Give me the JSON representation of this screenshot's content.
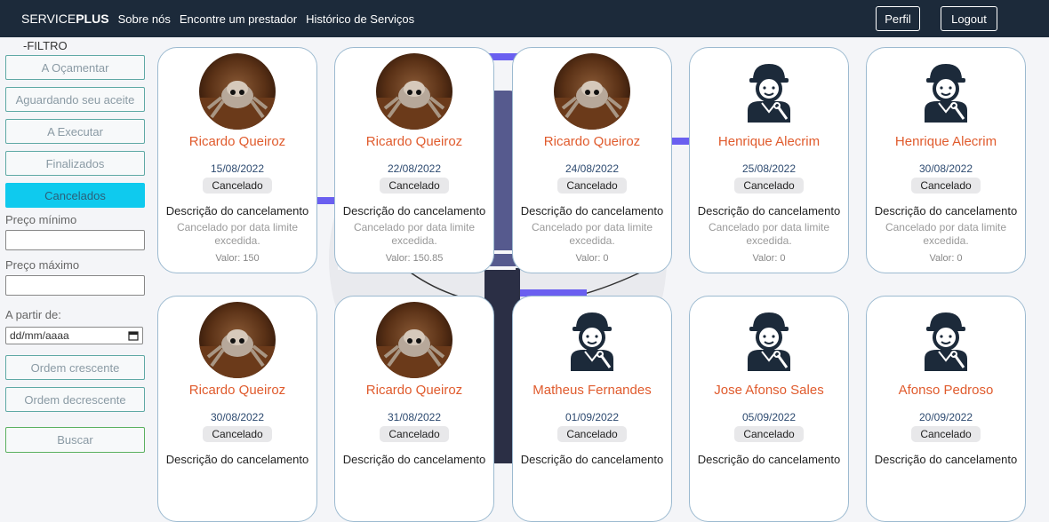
{
  "nav": {
    "brand_light": "SERVICE",
    "brand_bold": "PLUS",
    "links": [
      "Sobre nós",
      "Encontre um prestador",
      "Histórico de Serviços"
    ],
    "profile": "Perfil",
    "logout": "Logout"
  },
  "sidebar": {
    "title": "-FILTRO",
    "filters": [
      "A Oçamentar",
      "Aguardando seu aceite",
      "A Executar",
      "Finalizados",
      "Cancelados"
    ],
    "active_filter": "Cancelados",
    "min_price_label": "Preço mínimo",
    "max_price_label": "Preço máximo",
    "from_label": "A partir de:",
    "date_placeholder": "dd/mm/aaaa",
    "order_asc": "Ordem crescente",
    "order_desc": "Ordem decrescente",
    "search": "Buscar"
  },
  "colors": {
    "topbar": "#1c2a3a",
    "active_filter": "#0fcaee",
    "name": "#e05b2d",
    "date": "#2d4a70"
  },
  "cards": [
    {
      "avatar": "spider-photo",
      "name": "Ricardo Queiroz",
      "date": "15/08/2022",
      "status": "Cancelado",
      "desc_title": "Descrição do cancelamento",
      "desc": "Cancelado por data limite excedida.",
      "value": "Valor: 150"
    },
    {
      "avatar": "spider-photo",
      "name": "Ricardo Queiroz",
      "date": "22/08/2022",
      "status": "Cancelado",
      "desc_title": "Descrição do cancelamento",
      "desc": "Cancelado por data limite excedida.",
      "value": "Valor: 150.85"
    },
    {
      "avatar": "spider-photo",
      "name": "Ricardo Queiroz",
      "date": "24/08/2022",
      "status": "Cancelado",
      "desc_title": "Descrição do cancelamento",
      "desc": "Cancelado por data limite excedida.",
      "value": "Valor: 0"
    },
    {
      "avatar": "mechanic-icon",
      "name": "Henrique Alecrim",
      "date": "25/08/2022",
      "status": "Cancelado",
      "desc_title": "Descrição do cancelamento",
      "desc": "Cancelado por data limite excedida.",
      "value": "Valor: 0"
    },
    {
      "avatar": "mechanic-icon",
      "name": "Henrique Alecrim",
      "date": "30/08/2022",
      "status": "Cancelado",
      "desc_title": "Descrição do cancelamento",
      "desc": "Cancelado por data limite excedida.",
      "value": "Valor: 0"
    },
    {
      "avatar": "spider-photo",
      "name": "Ricardo Queiroz",
      "date": "30/08/2022",
      "status": "Cancelado",
      "desc_title": "Descrição do cancelamento",
      "desc": "",
      "value": ""
    },
    {
      "avatar": "spider-photo",
      "name": "Ricardo Queiroz",
      "date": "31/08/2022",
      "status": "Cancelado",
      "desc_title": "Descrição do cancelamento",
      "desc": "",
      "value": ""
    },
    {
      "avatar": "mechanic-icon",
      "name": "Matheus Fernandes",
      "date": "01/09/2022",
      "status": "Cancelado",
      "desc_title": "Descrição do cancelamento",
      "desc": "",
      "value": ""
    },
    {
      "avatar": "mechanic-icon",
      "name": "Jose Afonso Sales",
      "date": "05/09/2022",
      "status": "Cancelado",
      "desc_title": "Descrição do cancelamento",
      "desc": "",
      "value": ""
    },
    {
      "avatar": "mechanic-icon",
      "name": "Afonso Pedroso",
      "date": "20/09/2022",
      "status": "Cancelado",
      "desc_title": "Descrição do cancelamento",
      "desc": "",
      "value": ""
    }
  ]
}
